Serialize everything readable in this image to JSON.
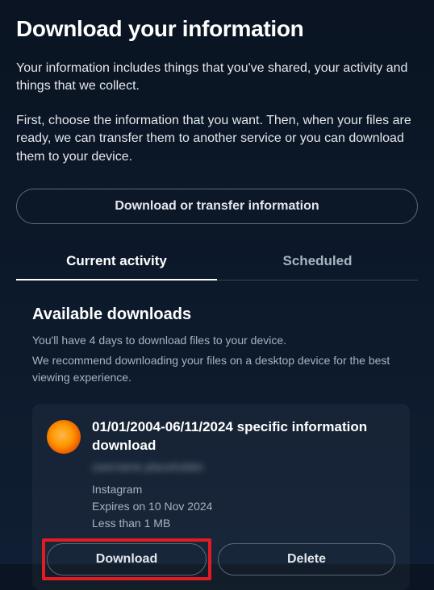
{
  "header": {
    "title": "Download your information",
    "description1": "Your information includes things that you've shared, your activity and things that we collect.",
    "description2": "First, choose the information that you want. Then, when your files are ready, we can transfer them to another service or you can download them to your device."
  },
  "primaryAction": {
    "label": "Download or transfer information"
  },
  "tabs": {
    "current": "Current activity",
    "scheduled": "Scheduled"
  },
  "available": {
    "title": "Available downloads",
    "subtitle1": "You'll have 4 days to download files to your device.",
    "subtitle2": "We recommend downloading your files on a desktop device for the best viewing experience."
  },
  "downloadItem": {
    "title": "01/01/2004-06/11/2024 specific information download",
    "blurred": "username placeholder",
    "platform": "Instagram",
    "expires": "Expires on 10 Nov 2024",
    "size": "Less than 1 MB",
    "downloadLabel": "Download",
    "deleteLabel": "Delete"
  }
}
